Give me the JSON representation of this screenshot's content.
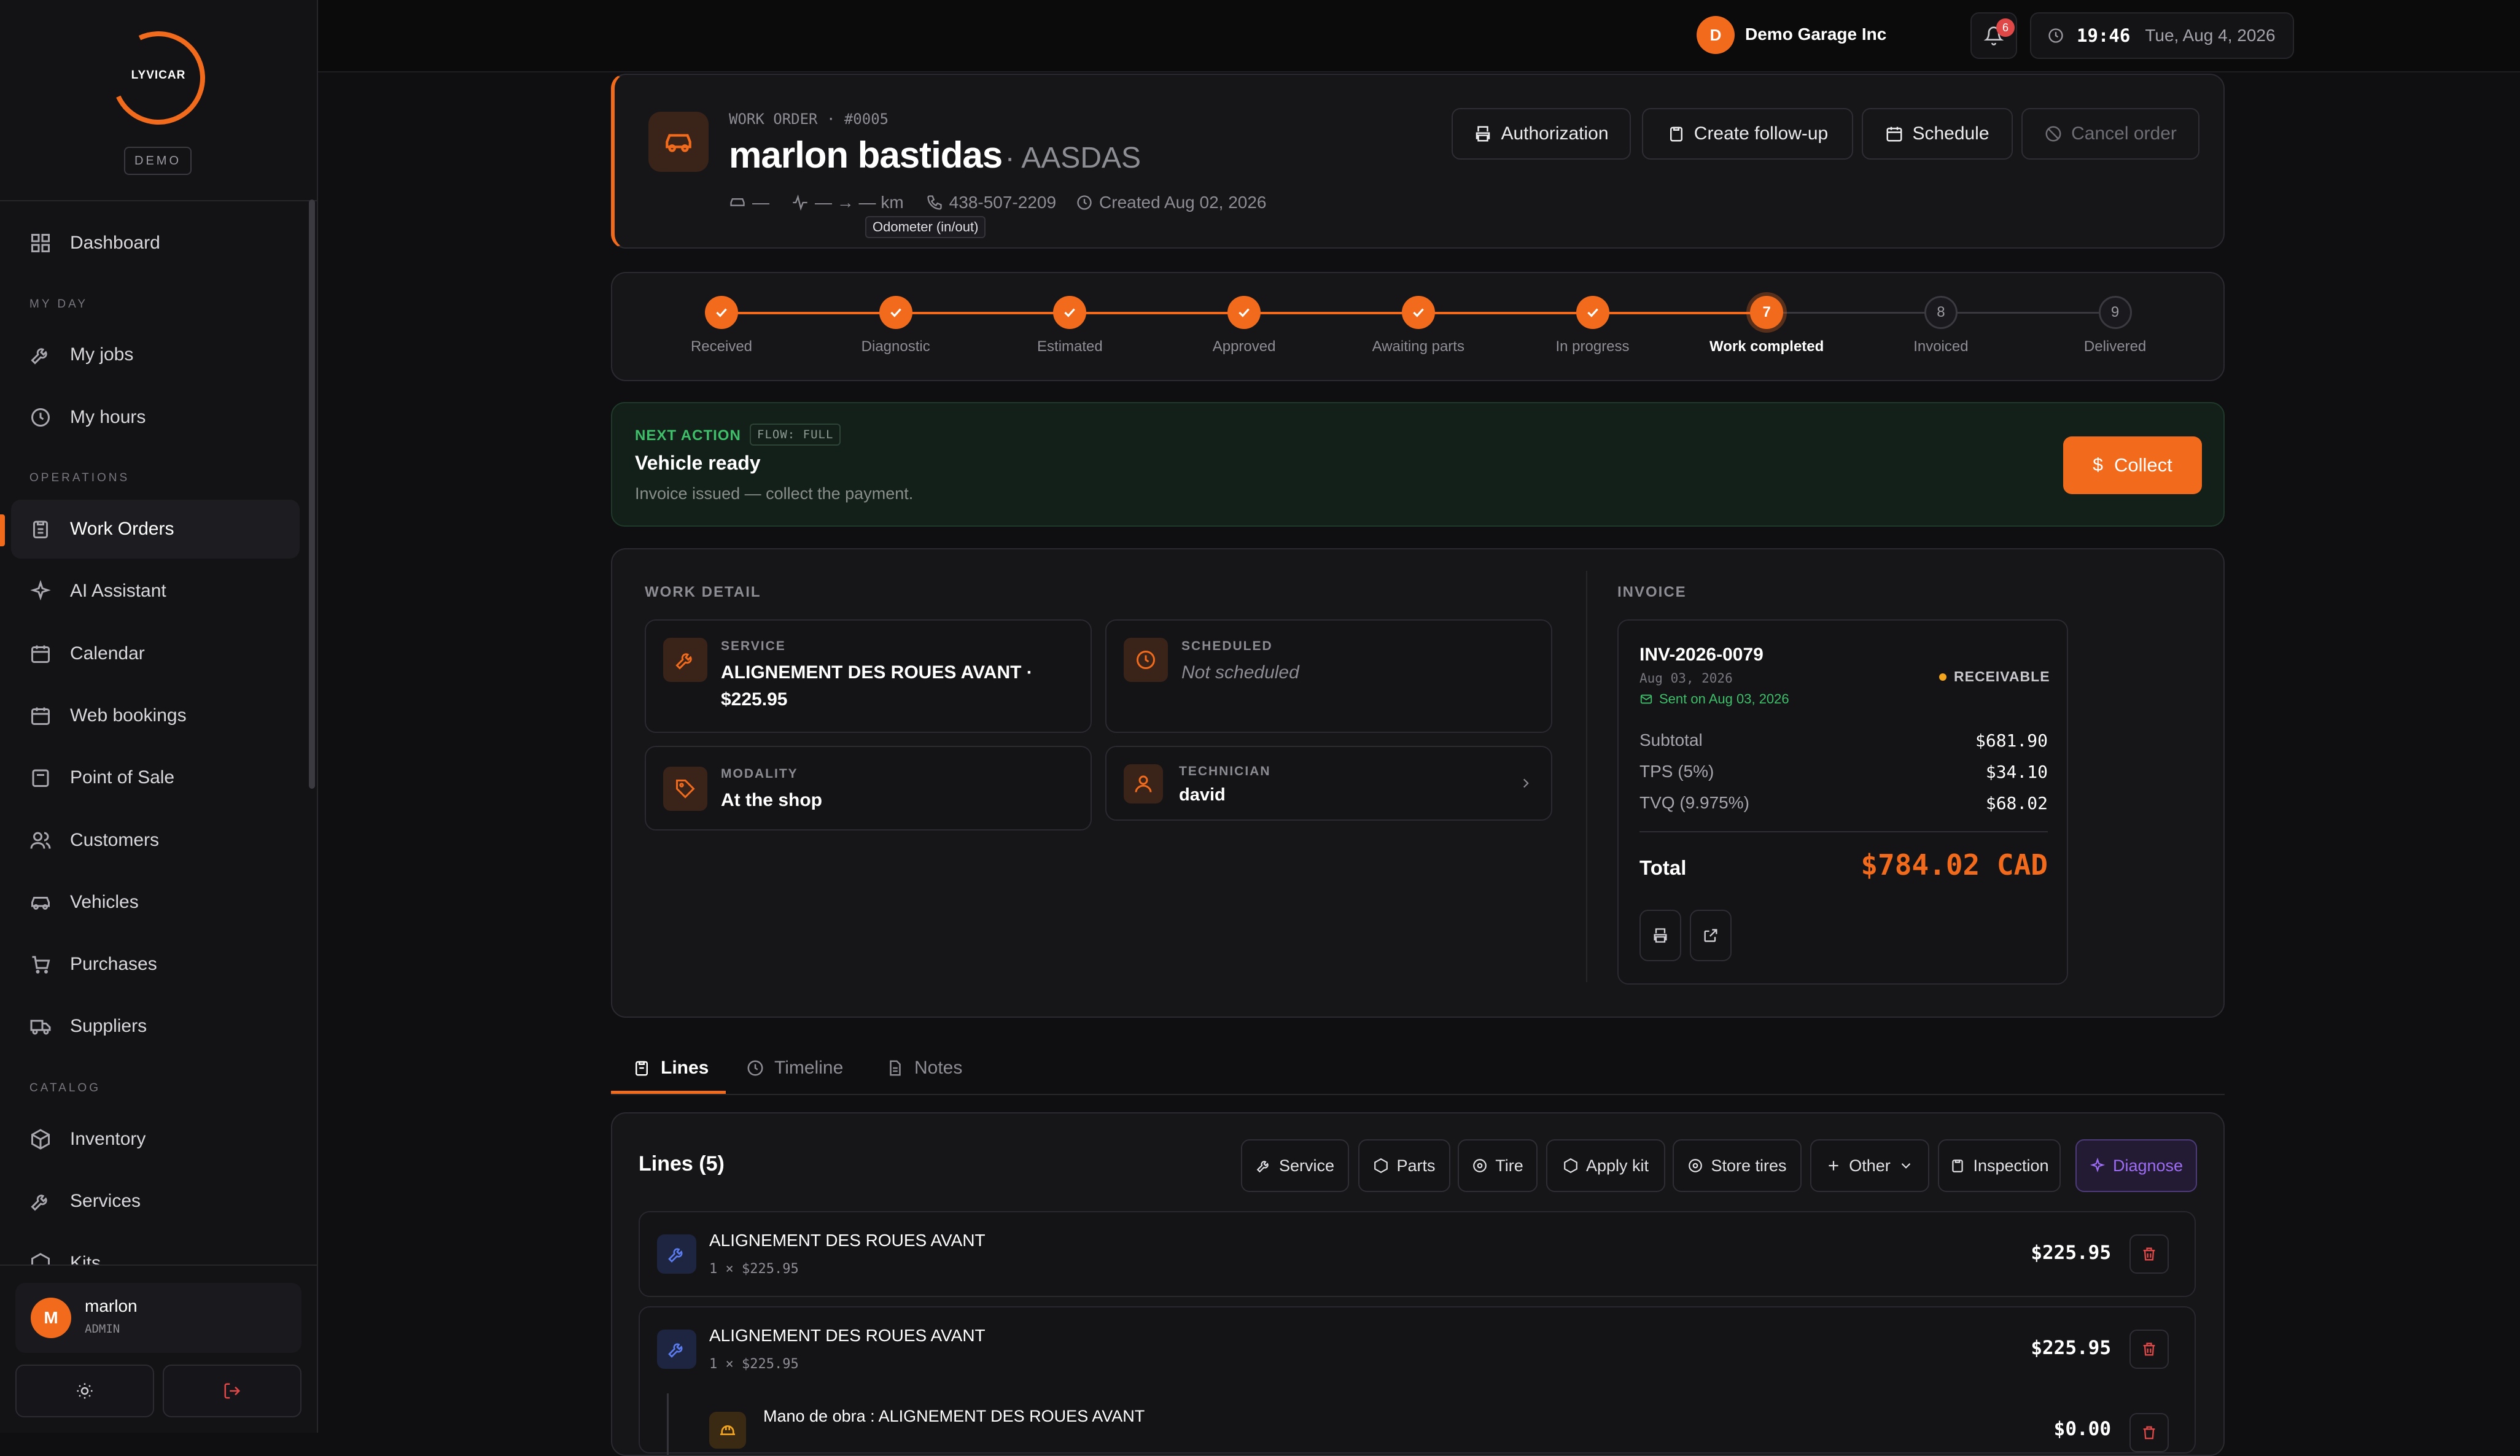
{
  "app": {
    "logo_text": "LYVICAR",
    "env_badge": "DEMO"
  },
  "sidebar": {
    "sections": {
      "my_day": "MY DAY",
      "operations": "OPERATIONS",
      "catalog": "CATALOG"
    },
    "items": [
      {
        "label": "Dashboard",
        "icon": "grid-icon"
      },
      {
        "label": "My jobs",
        "icon": "wrench-icon"
      },
      {
        "label": "My hours",
        "icon": "clock-icon"
      },
      {
        "label": "Work Orders",
        "icon": "clipboard-icon",
        "active": true
      },
      {
        "label": "AI Assistant",
        "icon": "sparkles-icon"
      },
      {
        "label": "Calendar",
        "icon": "calendar-icon"
      },
      {
        "label": "Web bookings",
        "icon": "calendar-check-icon"
      },
      {
        "label": "Point of Sale",
        "icon": "cash-register-icon"
      },
      {
        "label": "Customers",
        "icon": "users-icon"
      },
      {
        "label": "Vehicles",
        "icon": "car-icon"
      },
      {
        "label": "Purchases",
        "icon": "cart-icon"
      },
      {
        "label": "Suppliers",
        "icon": "truck-icon"
      },
      {
        "label": "Inventory",
        "icon": "box-icon"
      },
      {
        "label": "Services",
        "icon": "wrench-icon"
      },
      {
        "label": "Kits",
        "icon": "package-icon"
      }
    ],
    "user": {
      "initial": "M",
      "name": "marlon",
      "role": "ADMIN"
    }
  },
  "topbar": {
    "notifications": "6",
    "time": "19:46",
    "date": "Tue, Aug 4, 2026",
    "org_initial": "D",
    "org_name": "Demo Garage Inc"
  },
  "work_order": {
    "label": "WORK ORDER · #0005",
    "customer": "marlon bastidas",
    "suffix": "· AASDAS",
    "vehicle": "—",
    "odometer": "— → — km",
    "phone": "438-507-2209",
    "created": "Created Aug 02, 2026",
    "tooltip": "Odometer (in/out)",
    "actions": {
      "authorization": "Authorization",
      "follow_up": "Create follow-up",
      "schedule": "Schedule",
      "cancel": "Cancel order"
    }
  },
  "steps": [
    {
      "label": "Received",
      "state": "done"
    },
    {
      "label": "Diagnostic",
      "state": "done"
    },
    {
      "label": "Estimated",
      "state": "done"
    },
    {
      "label": "Approved",
      "state": "done"
    },
    {
      "label": "Awaiting parts",
      "state": "done"
    },
    {
      "label": "In progress",
      "state": "done"
    },
    {
      "label": "Work completed",
      "state": "current",
      "num": "7"
    },
    {
      "label": "Invoiced",
      "state": "todo",
      "num": "8"
    },
    {
      "label": "Delivered",
      "state": "todo",
      "num": "9"
    }
  ],
  "next_action": {
    "tag": "NEXT ACTION",
    "flow": "FLOW: FULL",
    "title": "Vehicle ready",
    "desc": "Invoice issued — collect the payment.",
    "button": "Collect"
  },
  "work_detail": {
    "heading": "WORK DETAIL",
    "service_label": "SERVICE",
    "service_value": "ALIGNEMENT DES ROUES AVANT ·",
    "service_price": "$225.95",
    "scheduled_label": "SCHEDULED",
    "scheduled_value": "Not scheduled",
    "modality_label": "MODALITY",
    "modality_value": "At the shop",
    "technician_label": "TECHNICIAN",
    "technician_value": "david"
  },
  "invoice": {
    "heading": "INVOICE",
    "number": "INV-2026-0079",
    "date": "Aug 03, 2026",
    "sent": "Sent on Aug 03, 2026",
    "status": "RECEIVABLE",
    "subtotal_label": "Subtotal",
    "subtotal": "$681.90",
    "tps_label": "TPS (5%)",
    "tps": "$34.10",
    "tvq_label": "TVQ (9.975%)",
    "tvq": "$68.02",
    "total_label": "Total",
    "total": "$784.02 CAD"
  },
  "tabs": {
    "lines": "Lines",
    "timeline": "Timeline",
    "notes": "Notes"
  },
  "lines": {
    "title": "Lines (5)",
    "buttons": {
      "service": "Service",
      "parts": "Parts",
      "tire": "Tire",
      "apply_kit": "Apply kit",
      "store_tires": "Store tires",
      "other": "Other",
      "inspection": "Inspection",
      "diagnose": "Diagnose"
    },
    "items": [
      {
        "name": "ALIGNEMENT DES ROUES AVANT",
        "qty": "1 × $225.95",
        "amount": "$225.95"
      },
      {
        "name": "ALIGNEMENT DES ROUES AVANT",
        "qty": "1 × $225.95",
        "amount": "$225.95"
      },
      {
        "name": "Mano de obra : ALIGNEMENT DES ROUES AVANT",
        "amount": "$0.00"
      }
    ]
  },
  "colors": {
    "accent": "#f26b1d",
    "success": "#3fbf6a",
    "danger": "#e04848",
    "diagnose": "#9d6cf5"
  }
}
